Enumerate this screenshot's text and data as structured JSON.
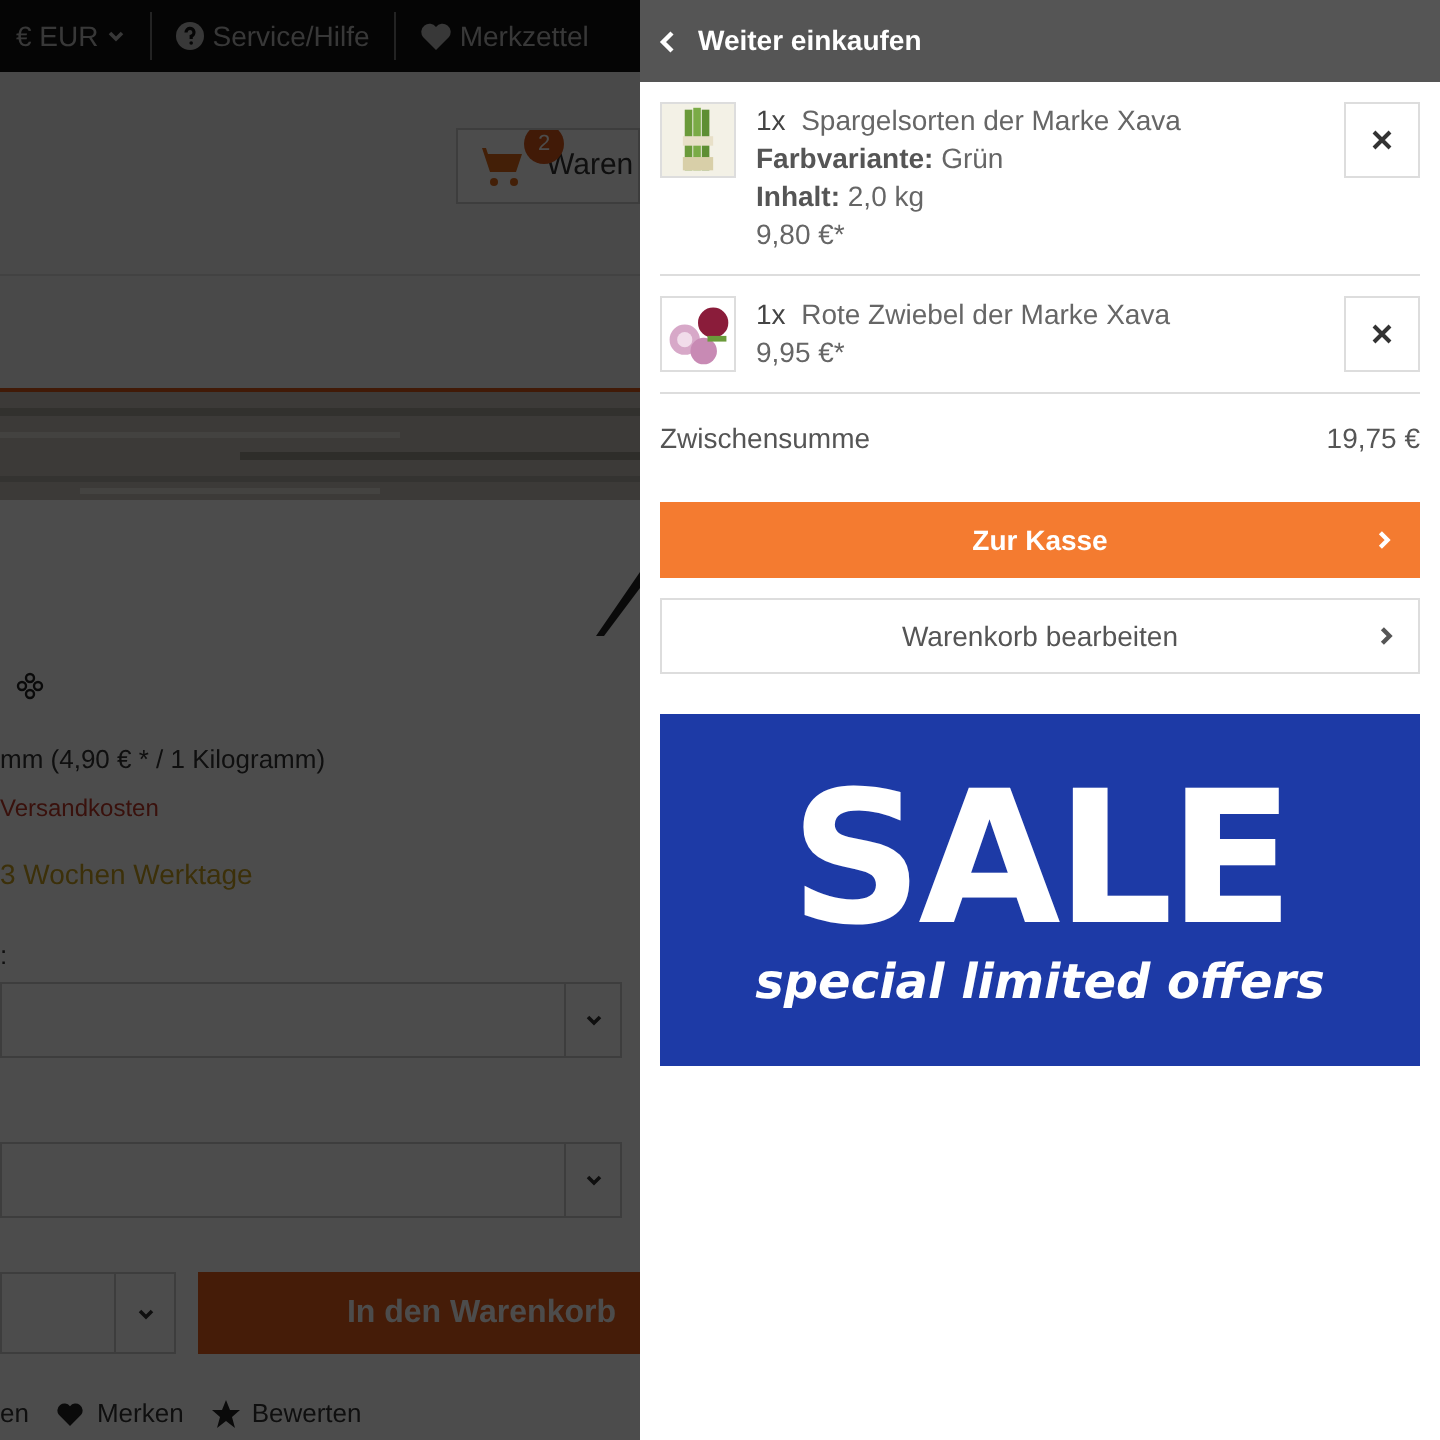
{
  "background_page": {
    "top_bar": {
      "currency": "€ EUR",
      "service": "Service/Hilfe",
      "wishlist": "Merkzettel"
    },
    "cart_button": {
      "badge": "2",
      "label": "Waren"
    },
    "product": {
      "unit_price": "mm (4,90 € * / 1 Kilogramm)",
      "shipping": "Versandkosten",
      "delivery": "3 Wochen Werktage",
      "option_label": ":",
      "add_to_cart": "In den Warenkorb",
      "actions": [
        "en",
        "Merken",
        "Bewerten"
      ]
    }
  },
  "cart_panel": {
    "back_label": "Weiter einkaufen",
    "items": [
      {
        "quantity": "1x",
        "name": "Spargelsorten der Marke Xava",
        "details": [
          {
            "label": "Farbvariante:",
            "value": "Grün"
          },
          {
            "label": "Inhalt:",
            "value": "2,0 kg"
          }
        ],
        "price": "9,80 €*"
      },
      {
        "quantity": "1x",
        "name": "Rote Zwiebel der Marke Xava",
        "price": "9,95 €*"
      }
    ],
    "subtotal_label": "Zwischensumme",
    "subtotal": "19,75 €",
    "checkout": "Zur Kasse",
    "edit_cart": "Warenkorb bearbeiten",
    "banner": {
      "headline": "SALE",
      "tagline": "special limited offers"
    }
  }
}
